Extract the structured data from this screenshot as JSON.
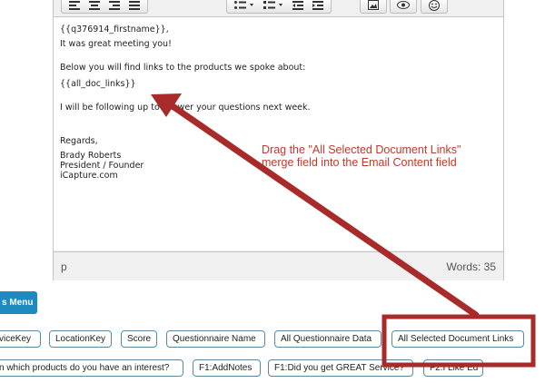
{
  "editor": {
    "content_lines": [
      "{{q376914_firstname}},",
      "It was great meeting you!",
      "Below you will find links to the products we spoke about:",
      "{{all_doc_links}}",
      "I will be following up to answer your questions next week.",
      "Regards,",
      "Brady Roberts",
      "President / Founder",
      "iCapture.com"
    ],
    "path_label": "p",
    "word_count": "Words: 35"
  },
  "merge_fields": {
    "menu_button_label": "s Menu",
    "row1": [
      "viceKey",
      "LocationKey",
      "Score",
      "Questionnaire Name",
      "All Questionnaire Data",
      "All Selected Document Links"
    ],
    "row2": [
      "n which products do you have an interest?",
      "F1:AddNotes",
      "F1:Did you get GREAT Service?",
      "F2:I Like Ed"
    ]
  },
  "annotation": {
    "line1": "Drag the \"All Selected Document Links\"",
    "line2": "merge field into the Email Content field"
  },
  "colors": {
    "accent": "#1d8ac0",
    "annotation_red": "#a82a2a",
    "annotation_text": "#c0392b"
  },
  "icons": [
    "align-left-icon",
    "align-center-icon",
    "align-right-icon",
    "align-justify-icon",
    "bullet-list-icon",
    "numbered-list-icon",
    "outdent-icon",
    "indent-icon",
    "image-icon",
    "preview-icon",
    "emoticon-icon"
  ]
}
